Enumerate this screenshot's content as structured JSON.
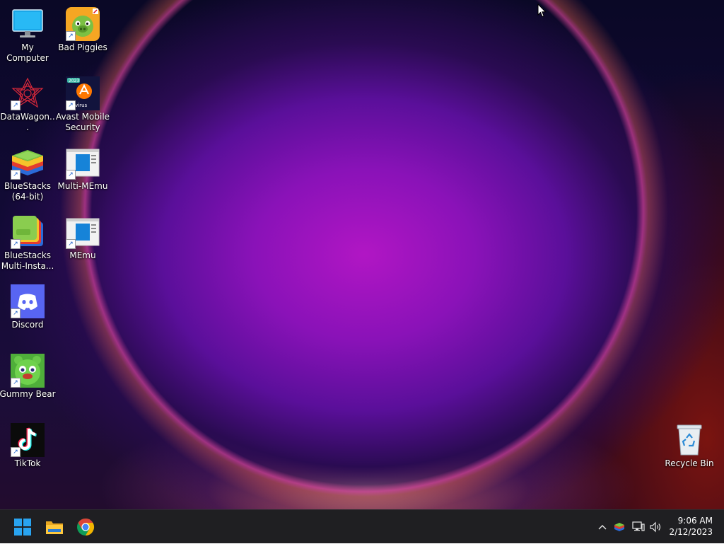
{
  "desktop": {
    "icons": [
      {
        "label": "My Computer",
        "icon": "monitor-icon"
      },
      {
        "label": "Bad Piggies",
        "icon": "bad-piggies-icon"
      },
      {
        "label": "DataWagon...",
        "icon": "datawagon-icon"
      },
      {
        "label": "Avast Mobile Security",
        "icon": "avast-icon",
        "badge_text": "2023",
        "tile_text": "ntivirus"
      },
      {
        "label": "BlueStacks (64-bit)",
        "icon": "bluestacks-icon"
      },
      {
        "label": "Multi-MEmu",
        "icon": "memu-icon"
      },
      {
        "label": "BlueStacks Multi-Insta...",
        "icon": "bluestacks-multi-icon"
      },
      {
        "label": "MEmu",
        "icon": "memu-icon"
      },
      {
        "label": "Discord",
        "icon": "discord-icon"
      },
      {
        "label": "Gummy Bear",
        "icon": "gummy-bear-icon"
      },
      {
        "label": "TikTok",
        "icon": "tiktok-icon"
      },
      {
        "label": "Recycle Bin",
        "icon": "recycle-bin-icon"
      }
    ]
  },
  "taskbar": {
    "pinned": [
      {
        "name": "Start",
        "icon": "windows-start-icon"
      },
      {
        "name": "File Explorer",
        "icon": "folder-icon"
      },
      {
        "name": "Google Chrome",
        "icon": "chrome-icon"
      }
    ],
    "tray": {
      "icons": [
        "chevron-up-icon",
        "bluestacks-tray-icon",
        "network-icon",
        "volume-icon"
      ]
    },
    "clock": {
      "time": "9:06 AM",
      "date": "2/12/2023"
    }
  },
  "colors": {
    "taskbar_bg": "#1f1f22",
    "accent_start": "#29a3f0",
    "discord": "#5865f2",
    "chrome_red": "#db4437",
    "chrome_yellow": "#f4b400",
    "chrome_green": "#0f9d58",
    "chrome_blue": "#4285f4"
  }
}
